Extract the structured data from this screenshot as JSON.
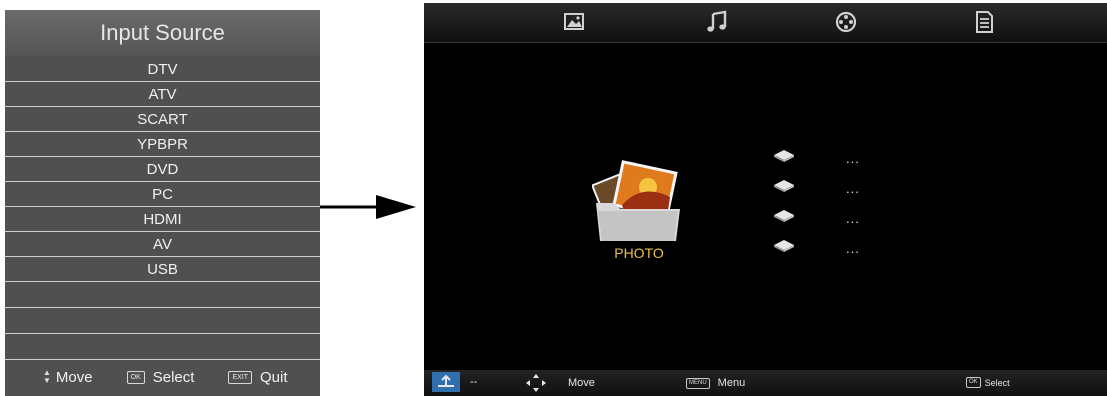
{
  "input_menu": {
    "title": "Input Source",
    "items": [
      "DTV",
      "ATV",
      "SCART",
      "YPBPR",
      "DVD",
      "PC",
      "HDMI",
      "AV",
      "USB"
    ],
    "footer": {
      "move_label": "Move",
      "select_key": "OK",
      "select_label": "Select",
      "quit_key": "EXIT",
      "quit_label": "Quit"
    }
  },
  "media_screen": {
    "tabs": [
      "photo-tab",
      "music-tab",
      "movie-tab",
      "text-tab"
    ],
    "photo_label": "PHOTO",
    "drives": [
      {
        "name": "...",
        "icon": "usb-drive-icon"
      },
      {
        "name": "...",
        "icon": "usb-drive-icon"
      },
      {
        "name": "...",
        "icon": "usb-drive-icon"
      },
      {
        "name": "...",
        "icon": "usb-drive-icon"
      }
    ],
    "bottom_bar": {
      "device_label": "--",
      "move_label": "Move",
      "menu_key": "MENU",
      "menu_label": "Menu",
      "select_key": "OK",
      "select_label": "Select"
    }
  },
  "colors": {
    "menu_background": "#505050",
    "photo_label": "#e8c24b",
    "screen_background": "#000000"
  }
}
